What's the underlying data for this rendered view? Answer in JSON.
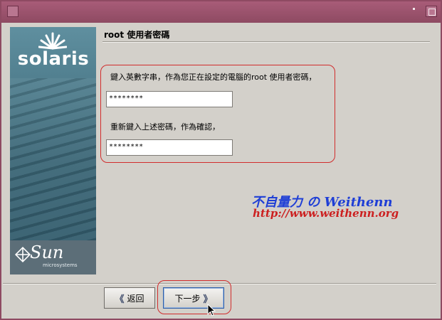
{
  "window": {
    "title_bar_color": "#8e4a62"
  },
  "sidebar": {
    "brand": "solaris",
    "vendor_logo": "Sun",
    "vendor_sub": "microsystems"
  },
  "page": {
    "heading": "root 使用者密碼"
  },
  "form": {
    "password_label": "鍵入英數字串，作為您正在設定的電腦的root 使用者密碼，",
    "password_value": "********",
    "confirm_label": "重新鍵入上述密碼，作為確認，",
    "confirm_value": "********",
    "highlight_color": "#d12c2c"
  },
  "watermark": {
    "line1": "不自量力 の Weithenn",
    "line2": "http://www.weithenn.org"
  },
  "footer": {
    "back_label": "返回",
    "next_label": "下一步",
    "back_icon": "double-chevron-left-icon",
    "next_icon": "double-chevron-right-icon"
  }
}
